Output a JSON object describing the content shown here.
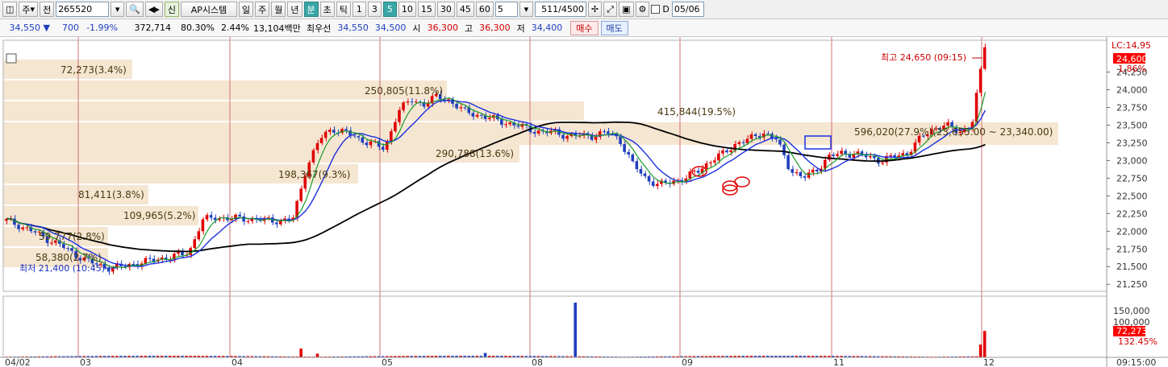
{
  "toolbar": {
    "mode_label": "주",
    "prev_label": "전",
    "code_value": "265520",
    "sin_label": "신",
    "system_label": "AP시스템",
    "period_day": "일",
    "period_week": "주",
    "period_month": "월",
    "period_year": "년",
    "period_min": "분",
    "period_sec": "초",
    "period_tick": "틱",
    "intervals": [
      "1",
      "3",
      "5",
      "10",
      "15",
      "30",
      "45",
      "60"
    ],
    "active_interval": "5",
    "interval_input": "5",
    "count_value": "511",
    "count_total": "/4500",
    "date_value": "05/06",
    "d_label": "D"
  },
  "quote": {
    "price": "34,550",
    "direction_glyph": "▼",
    "change": "700",
    "change_pct": "-1.99%",
    "volume": "372,714",
    "vol_ratio": "80.30%",
    "turnover_ratio": "2.44%",
    "amount": "13,104백만",
    "priority_label": "최우선",
    "ask": "34,550",
    "bid": "34,500",
    "open_label": "시",
    "open": "36,300",
    "high_label": "고",
    "high": "36,300",
    "low_label": "저",
    "low": "34,400",
    "buy_label": "매수",
    "sell_label": "매도"
  },
  "chart": {
    "price_axis_top_label": "LC:14,95",
    "price_ticks": [
      "24,250",
      "24,000",
      "23,750",
      "23,500",
      "23,250",
      "23,000",
      "22,750",
      "22,500",
      "22,250",
      "22,000",
      "21,750",
      "21,500",
      "21,250"
    ],
    "current_price_tag": "24,600",
    "current_pct_tag": "1.86%",
    "volume_ticks": [
      "150,000",
      "100,000"
    ],
    "volume_tag": "72,273",
    "volume_pct_tag": "132.45%",
    "time_axis_end_label": "09:15:00",
    "date_labels": [
      "04/02",
      "03",
      "04",
      "05",
      "08",
      "09",
      "11",
      "12"
    ],
    "profile_labels": [
      "72,273(3.4%)",
      "250,805(11.8%)",
      "415,844(19.5%)",
      "596,020(27.9%)(23,655.00 ~ 23,340.00)",
      "290,788(13.6%)",
      "198,367(9.3%)",
      "81,411(3.8%)",
      "109,965(5.2%)",
      "59,777(2.8%)",
      "58,380(2.7%)"
    ],
    "high_annotation": "최고 24,650 (09:15)",
    "low_annotation": "최저 21,400 (10:45)"
  },
  "colors": {
    "up": "#e00000",
    "down": "#1f3fbf",
    "ma_black": "#000000",
    "ma_green": "#1a9a2a",
    "ma_blue": "#1a2fe0",
    "profile": "#f5e6d2",
    "vline": "#d07070"
  },
  "chart_data": {
    "type": "candlestick",
    "x_sessions": [
      "04/02",
      "03",
      "04",
      "05",
      "08",
      "09",
      "11",
      "12"
    ],
    "ylim": [
      21150,
      24700
    ],
    "price_high": 24650,
    "price_low": 21400,
    "close_series_sample": [
      22150,
      22080,
      22000,
      21900,
      21820,
      21700,
      21600,
      21520,
      21480,
      21500,
      21550,
      21580,
      21620,
      21650,
      21700,
      22150,
      22200,
      22180,
      22180,
      22170,
      22150,
      22150,
      22180,
      22900,
      23300,
      23450,
      23400,
      23300,
      23250,
      23150,
      23700,
      23850,
      23800,
      23900,
      23850,
      23700,
      23650,
      23600,
      23550,
      23500,
      23450,
      23400,
      23400,
      23350,
      23350,
      23350,
      23400,
      23300,
      22950,
      22750,
      22650,
      22700,
      22750,
      22850,
      23000,
      23100,
      23250,
      23300,
      23400,
      23300,
      22900,
      22750,
      22850,
      23050,
      23100,
      23100,
      23050,
      23000,
      23050,
      23100,
      23300,
      23450,
      23500,
      23400,
      23500,
      24600
    ],
    "volume_max_tick": 150000
  }
}
